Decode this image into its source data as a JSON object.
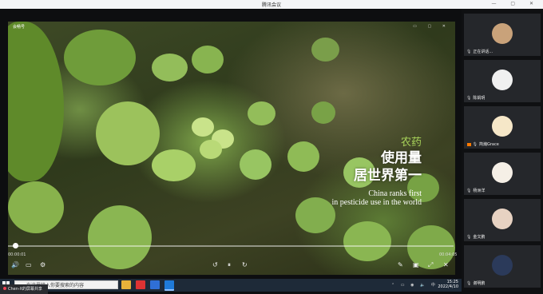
{
  "window": {
    "title": "腾讯会议",
    "controls": "— ▢ ✕"
  },
  "video": {
    "label": "会畅号",
    "window_buttons": "▭ ▢ ✕"
  },
  "caption": {
    "line1": "农药",
    "line2": "使用量",
    "line3": "居世界第一",
    "en1": "China ranks first",
    "en2": "in pesticide use in the world"
  },
  "player": {
    "time_start": "00:00:01",
    "time_end": "00:04:05",
    "progress": 0.01
  },
  "taskbar": {
    "search_placeholder": "在这里输入你要搜索的内容",
    "time": "15:25",
    "date": "2022/4/10"
  },
  "share": {
    "label": "Chen-X的屏幕共享"
  },
  "participants": [
    {
      "name": "正在讲话..."
    },
    {
      "name": "陈娟玥"
    },
    {
      "name": "简瀚Grace"
    },
    {
      "name": "杨洲洋"
    },
    {
      "name": "金文鹏"
    },
    {
      "name": "谢明鹏"
    }
  ],
  "colors": {
    "accent": "#a8d35a",
    "taskbar": "#1e2a38",
    "side": "#0f1012"
  }
}
